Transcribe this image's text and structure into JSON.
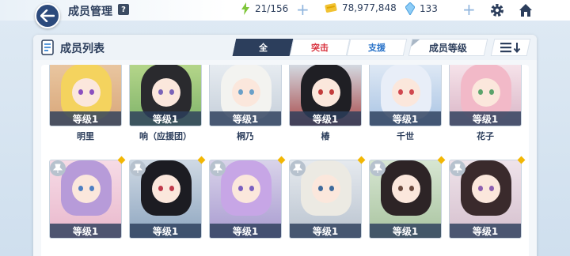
{
  "header": {
    "title": "成员管理",
    "help_label": "?",
    "ap": "21/156",
    "credits": "78,977,848",
    "gems": "133",
    "plus_label": "+"
  },
  "icons": {
    "back": "back-arrow-icon",
    "ap": "lightning-icon",
    "credits": "credit-card-icon",
    "gems": "gem-icon",
    "settings": "gear-icon",
    "home": "home-icon"
  },
  "colors": {
    "navy": "#2c3e5c",
    "striker_red": "#d8333e",
    "special_blue": "#2b74c9",
    "accent_yellow": "#f2b705"
  },
  "panel": {
    "title": "成员列表",
    "tabs": [
      {
        "label": "全",
        "active": true
      },
      {
        "label": "突击",
        "active": false
      },
      {
        "label": "支援",
        "active": false
      }
    ],
    "sort_label": "成员等级"
  },
  "cards_row1": [
    {
      "level": "等级1",
      "name": "明里"
    },
    {
      "level": "等级1",
      "name": "响（应援团）"
    },
    {
      "level": "等级1",
      "name": "桐乃"
    },
    {
      "level": "等级1",
      "name": "椿"
    },
    {
      "level": "等级1",
      "name": "千世"
    },
    {
      "level": "等级1",
      "name": "花子"
    }
  ],
  "cards_row2": [
    {
      "level": "等级1"
    },
    {
      "level": "等级1"
    },
    {
      "level": "等级1"
    },
    {
      "level": "等级1"
    },
    {
      "level": "等级1"
    },
    {
      "level": "等级1"
    }
  ]
}
